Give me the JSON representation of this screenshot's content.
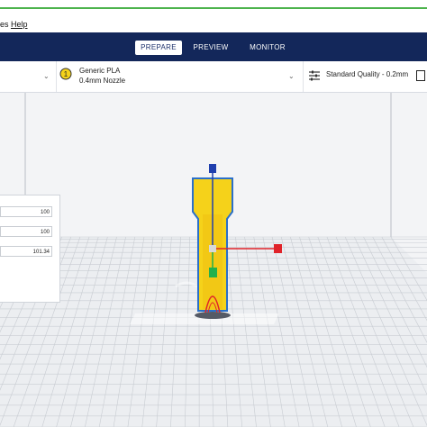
{
  "menu": {
    "items": [
      "es",
      "Help"
    ]
  },
  "stages": {
    "tabs": [
      {
        "label": "PREPARE",
        "active": true
      },
      {
        "label": "PREVIEW",
        "active": false
      },
      {
        "label": "MONITOR",
        "active": false
      }
    ]
  },
  "material": {
    "name": "Generic PLA",
    "nozzle": "0.4mm Nozzle",
    "badge": "1"
  },
  "quality": {
    "label": "Standard Quality - 0.2mm"
  },
  "transform_panel": {
    "values": [
      "100",
      "100",
      "101.34"
    ]
  },
  "colors": {
    "header_bg": "#13275a",
    "model_fill": "#f5d21a",
    "model_outline": "#2a6fc9",
    "axis_x": "#e0232a",
    "axis_y": "#22b14c",
    "axis_z": "#1f3fae",
    "build_plate_grid": "#c8ccd2",
    "accent_line": "#4cb34c"
  },
  "icons": [
    "settings-sliders-icon",
    "chevron-down-icon",
    "material-spool-icon"
  ]
}
